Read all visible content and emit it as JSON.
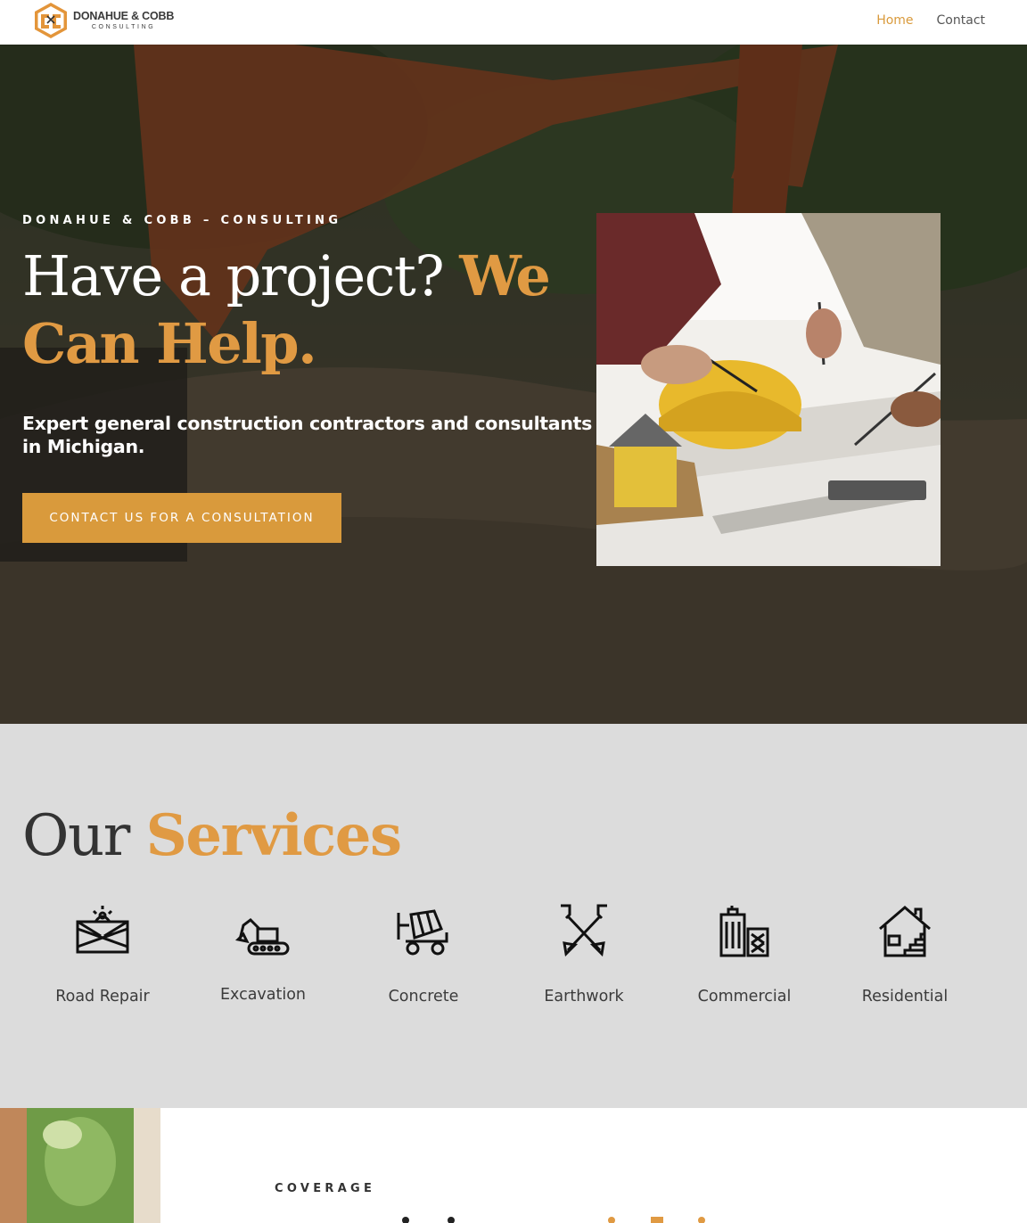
{
  "header": {
    "logo": {
      "name": "DONAHUE & COBB",
      "sub": "CONSULTING"
    },
    "nav": [
      {
        "label": "Home",
        "active": true
      },
      {
        "label": "Contact",
        "active": false
      }
    ]
  },
  "hero": {
    "eyebrow": "DONAHUE & COBB – CONSULTING",
    "title_plain": "Have a project? ",
    "title_accent": "We Can Help.",
    "subtitle": "Expert general construction contractors and consultants in Michigan.",
    "cta_label": "CONTACT US FOR A CONSULTATION"
  },
  "services": {
    "title_plain": "Our ",
    "title_accent": "Services",
    "items": [
      {
        "label": "Road Repair",
        "icon": "road-barrier-icon"
      },
      {
        "label": "Excavation",
        "icon": "excavator-icon"
      },
      {
        "label": "Concrete",
        "icon": "cement-mixer-icon"
      },
      {
        "label": "Earthwork",
        "icon": "crossed-shovels-icon"
      },
      {
        "label": "Commercial",
        "icon": "buildings-icon"
      },
      {
        "label": "Residential",
        "icon": "house-icon"
      }
    ]
  },
  "coverage": {
    "eyebrow": "COVERAGE"
  },
  "colors": {
    "accent": "#d99a3c",
    "accent_text": "#e09a43",
    "services_bg": "#dcdcdc"
  }
}
